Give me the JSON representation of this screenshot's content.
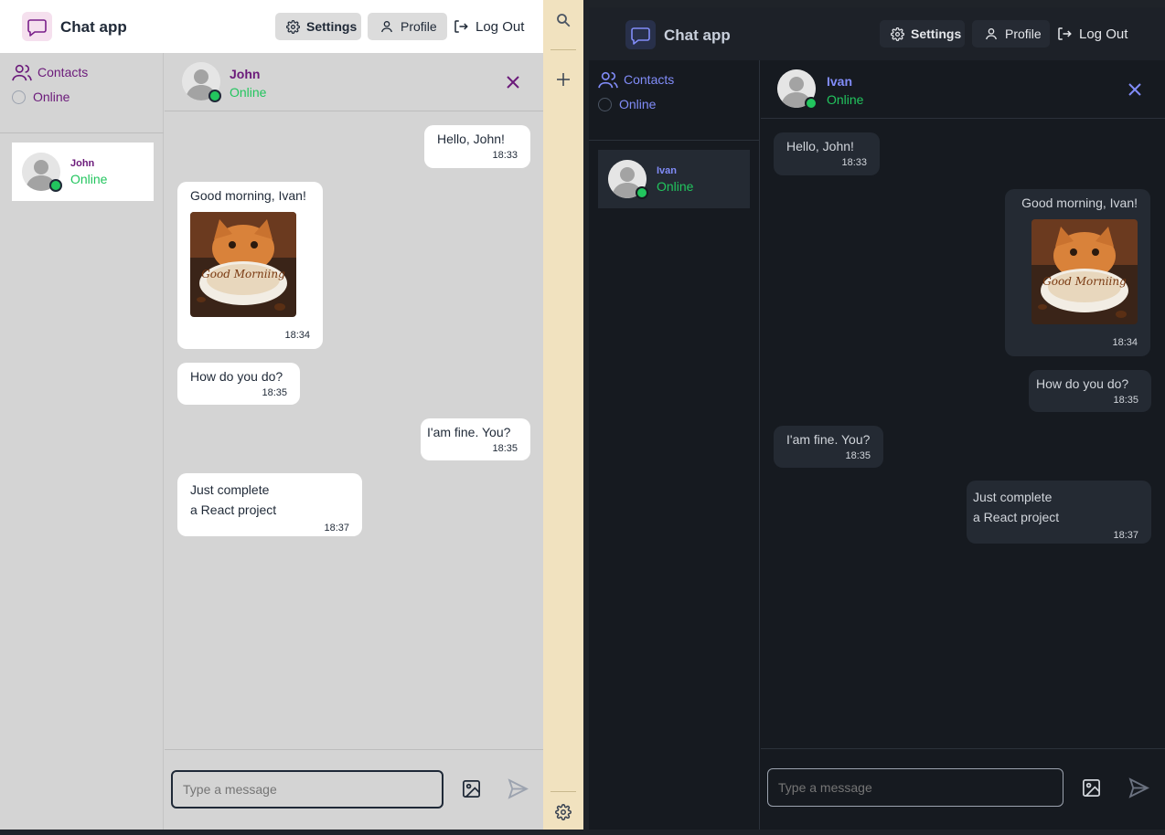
{
  "left": {
    "app_title": "Chat app",
    "nav": {
      "settings": "Settings",
      "profile": "Profile",
      "logout": "Log Out"
    },
    "sidebar": {
      "contacts_label": "Contacts",
      "online_label": "Online"
    },
    "contact": {
      "name": "John",
      "status": "Online"
    },
    "chat_header": {
      "name": "John",
      "status": "Online"
    },
    "messages": [
      {
        "text": "Hello, John!",
        "time": "18:33",
        "side": "right"
      },
      {
        "text": "Good morning, Ivan!",
        "time": "18:34",
        "side": "left",
        "image": "Good Morniing"
      },
      {
        "text": "How do you do?",
        "time": "18:35",
        "side": "left"
      },
      {
        "text": "I'am fine. You?",
        "time": "18:35",
        "side": "right"
      },
      {
        "line1": "Just complete",
        "line2": "a React project",
        "time": "18:37",
        "side": "left"
      }
    ],
    "input_placeholder": "Type a message"
  },
  "right": {
    "app_title": "Chat app",
    "nav": {
      "settings": "Settings",
      "profile": "Profile",
      "logout": "Log Out"
    },
    "sidebar": {
      "contacts_label": "Contacts",
      "online_label": "Online"
    },
    "contact": {
      "name": "Ivan",
      "status": "Online"
    },
    "chat_header": {
      "name": "Ivan",
      "status": "Online"
    },
    "messages": [
      {
        "text": "Hello, John!",
        "time": "18:33",
        "side": "left"
      },
      {
        "text": "Good morning, Ivan!",
        "time": "18:34",
        "side": "right",
        "image": "Good Morniing"
      },
      {
        "text": "How do you do?",
        "time": "18:35",
        "side": "right"
      },
      {
        "text": "I'am fine. You?",
        "time": "18:35",
        "side": "left"
      },
      {
        "line1": "Just complete",
        "line2": "a React project",
        "time": "18:37",
        "side": "right"
      }
    ],
    "input_placeholder": "Type a message"
  },
  "colors": {
    "accent_purple": "#6b1a7a",
    "accent_dark_blue": "#818cf8",
    "online_green": "#22c55e"
  },
  "icons": [
    "chat-bubble-icon",
    "gear-icon",
    "user-icon",
    "logout-icon",
    "users-icon",
    "close-icon",
    "image-icon",
    "send-icon",
    "search-icon",
    "plus-icon"
  ]
}
